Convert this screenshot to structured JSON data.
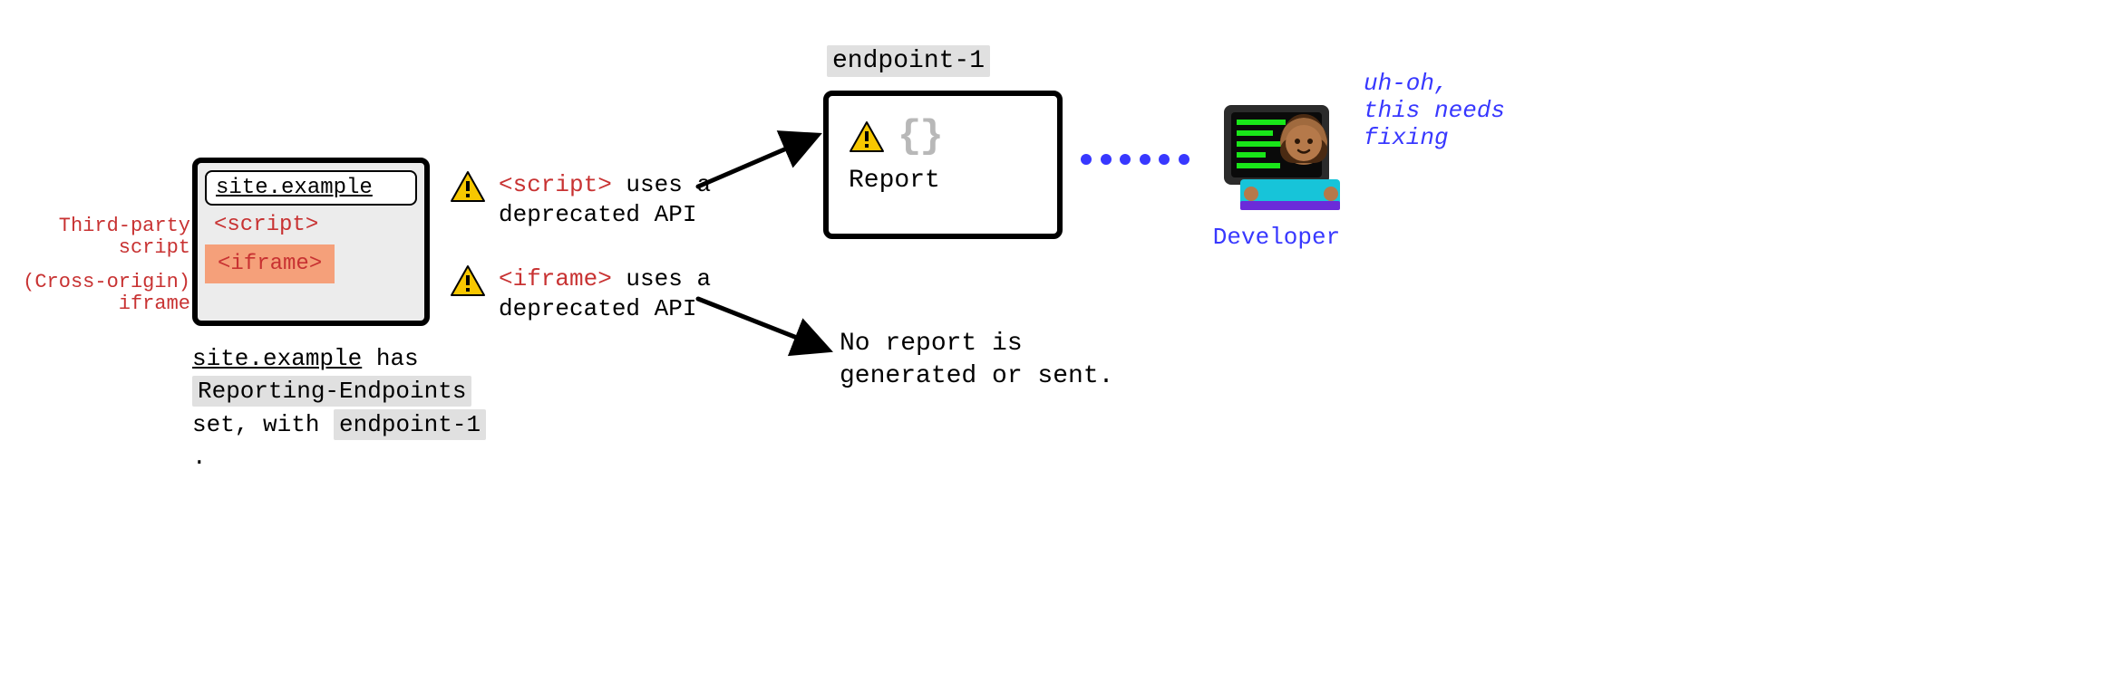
{
  "left_annotations": {
    "script": "Third-party script",
    "iframe": "(Cross-origin) iframe"
  },
  "browser": {
    "address": "site.example",
    "script_tag": "<script>",
    "iframe_tag": "<iframe>"
  },
  "browser_caption": {
    "line1_ul": "site.example",
    "line1_rest": " has ",
    "line2_hl": "Reporting-Endpoints",
    "line3_pre": "set, with ",
    "line3_hl": "endpoint-1",
    "line3_post": " ."
  },
  "warnings": {
    "script": {
      "code": "<script>",
      "rest": " uses a deprecated API"
    },
    "iframe": {
      "code": "<iframe>",
      "rest": " uses a deprecated API"
    }
  },
  "endpoint": {
    "label": "endpoint-1",
    "braces": "{}",
    "report": "Report"
  },
  "no_report": "No report is generated or sent.",
  "developer": {
    "label": "Developer",
    "thought": "uh-oh, this needs fixing"
  }
}
